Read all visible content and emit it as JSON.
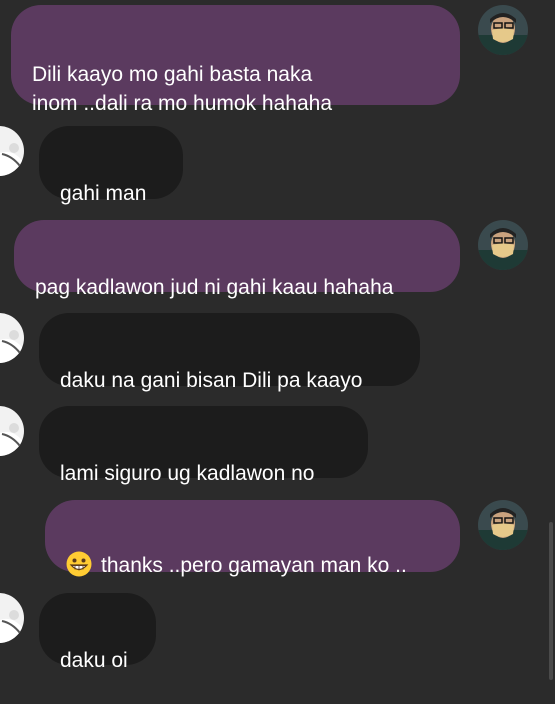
{
  "conversation": {
    "messages": [
      {
        "direction": "sent",
        "text": "Dili kaayo mo gahi basta naka\ninom ..dali ra mo humok hahaha"
      },
      {
        "direction": "received",
        "text": "gahi man"
      },
      {
        "direction": "sent",
        "text": "pag kadlawon jud ni gahi kaau hahaha"
      },
      {
        "direction": "received",
        "text": "daku na gani bisan Dili pa kaayo"
      },
      {
        "direction": "received",
        "text": "lami siguro ug kadlawon no"
      },
      {
        "direction": "sent",
        "emoji": "grinning-face",
        "text": "thanks ..pero gamayan man ko .."
      },
      {
        "direction": "received",
        "text": "daku oi"
      }
    ]
  },
  "colors": {
    "background": "#2b2b2b",
    "sent_bubble": "#5b3a5f",
    "received_bubble": "#1c1c1c",
    "text": "#ffffff"
  }
}
